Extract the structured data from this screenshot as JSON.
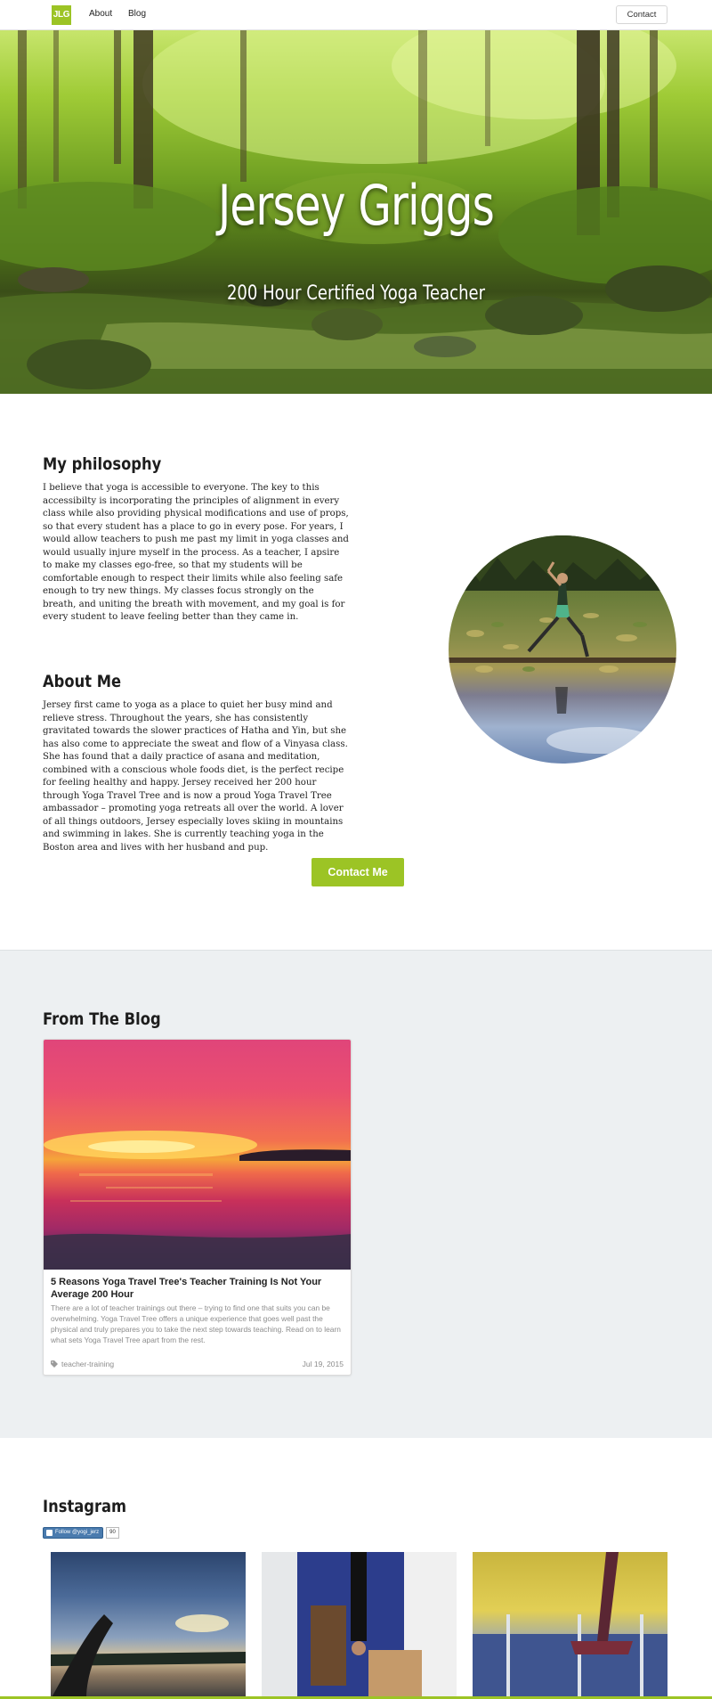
{
  "nav": {
    "logo": "JLG",
    "links": [
      "About",
      "Blog"
    ],
    "contact": "Contact"
  },
  "hero": {
    "title": "Jersey Griggs",
    "subtitle": "200 Hour Certified Yoga Teacher"
  },
  "philosophy": {
    "heading": "My philosophy",
    "text": "I believe that yoga is accessible to everyone. The key to this accessibilty is incorporating the principles of alignment in every class while also providing physical modifications and use of props, so that every student has a place to go in every pose. For years, I would allow teachers to push me past my limit in yoga classes and would usually injure myself in the process. As a teacher, I apsire to make my classes ego-free, so that my students will be comfortable enough to respect their limits while also feeling safe enough to try new things. My classes focus strongly on the breath, and uniting the breath with movement, and my goal is for every student to leave feeling better than they came in."
  },
  "about": {
    "heading": "About Me",
    "text": "Jersey first came to yoga as a place to quiet her busy mind and relieve stress. Throughout the years, she has consistently gravitated towards the slower practices of Hatha and Yin, but she has also come to appreciate the sweat and flow of a Vinyasa class. She has found that a daily practice of asana and meditation, combined with a conscious whole foods diet, is the perfect recipe for feeling healthy and happy. Jersey received her 200 hour through Yoga Travel Tree and is now a proud Yoga Travel Tree ambassador – promoting yoga retreats all over the world. A lover of all things outdoors, Jersey especially loves skiing in mountains and swimming in lakes. She is currently teaching yoga in the Boston area and lives with her husband and pup.",
    "cta": "Contact Me"
  },
  "blog": {
    "heading": "From The Blog",
    "post": {
      "title": "5 Reasons Yoga Travel Tree's Teacher Training Is Not Your Average 200 Hour",
      "excerpt": "There are a lot of teacher trainings out there – trying to find one that suits you can be overwhelming. Yoga Travel Tree offers a unique experience that goes well past the physical and truly prepares you to take the next step towards teaching. Read on to learn what sets Yoga Travel Tree apart from the rest.",
      "tag": "teacher-training",
      "date": "Jul 19, 2015"
    }
  },
  "instagram": {
    "heading": "Instagram",
    "follow_label": "Follow @yogi_jerz",
    "follow_count": "90"
  },
  "colors": {
    "accent": "#9cc425",
    "blog_bg": "#edf0f2"
  }
}
